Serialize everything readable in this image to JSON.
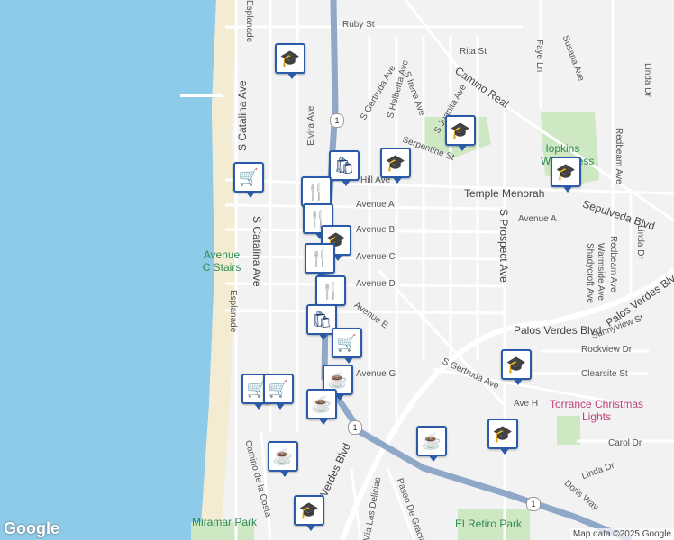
{
  "colors": {
    "ocean": "#8ecbe8",
    "beach": "#f3ecd2",
    "land": "#f2f2f2",
    "road": "#ffffff",
    "highway": "#8fa8c8",
    "park": "#cfe8c4",
    "marker": "#2a5aa8"
  },
  "labels": {
    "ruby": "Ruby St",
    "rita": "Rita St",
    "caminoReal": "Camino Real",
    "serpentine": "Serpentine St",
    "hopkins": "Hopkins Wilderness",
    "templeMenorah": "Temple Menorah",
    "sepulveda": "Sepulveda Blvd",
    "avenueA": "Avenue A",
    "avenueA2": "Avenue A",
    "avenueB": "Avenue B",
    "avenueC": "Avenue C",
    "avenueD": "Avenue D",
    "avenueE": "Avenue E",
    "avenueG": "Avenue G",
    "avenueH": "Ave H",
    "hillAve": "Hill Ave",
    "avenueCStairs": "Avenue C Stairs",
    "catalina1": "S Catalina Ave",
    "catalina2": "S Catalina Ave",
    "esplanade1": "Esplanade",
    "esplanade2": "Esplanade",
    "elvira": "Elvira Ave",
    "gertruda1": "S Gertruda Ave",
    "gertruda2": "S Gertruda Ave",
    "helberta": "S Helberta Ave",
    "irena": "S Irena Ave",
    "juanita": "S Juanita Ave",
    "prospect": "S Prospect Ave",
    "palosVerdes1": "Palos Verdes Blvd",
    "palosVerdes2": "Palos Verdes Blvd",
    "palosVerdes3": "Verdes Blvd",
    "shadycroft": "Shadycroft Ave",
    "warmside": "Warmside Ave",
    "redbeam1": "Redbeam Ave",
    "redbeam2": "Redbeam Ave",
    "linda1": "Linda Dr",
    "linda2": "Linda Dr",
    "linda3": "Linda Dr",
    "fayeLn": "Faye Ln",
    "susana": "Susana Ave",
    "sunnyview": "Sunnyview St",
    "rockview": "Rockview Dr",
    "clearsite": "Clearsite St",
    "carol": "Carol Dr",
    "doris": "Doris Way",
    "caminoCosta": "Camino de la Costa",
    "lasDelicias": "Vía Las Delicias",
    "pasoGracia": "Paseo De Gracia",
    "miramar": "Miramar Park",
    "elRetiro": "El Retiro Park",
    "torrance": "Torrance Christmas Lights",
    "hwy1a": "1",
    "hwy1b": "1",
    "hwy1c": "1"
  },
  "footer": {
    "brand": "Google",
    "copyright": "Map data ©2025 Google"
  },
  "markers": [
    "school-icon",
    "shopping-cart-icon",
    "restaurant-icon",
    "shopping-bag-icon",
    "school-icon",
    "school-icon",
    "coffee-icon",
    "school-icon",
    "school-icon",
    "school-icon",
    "coffee-icon"
  ]
}
